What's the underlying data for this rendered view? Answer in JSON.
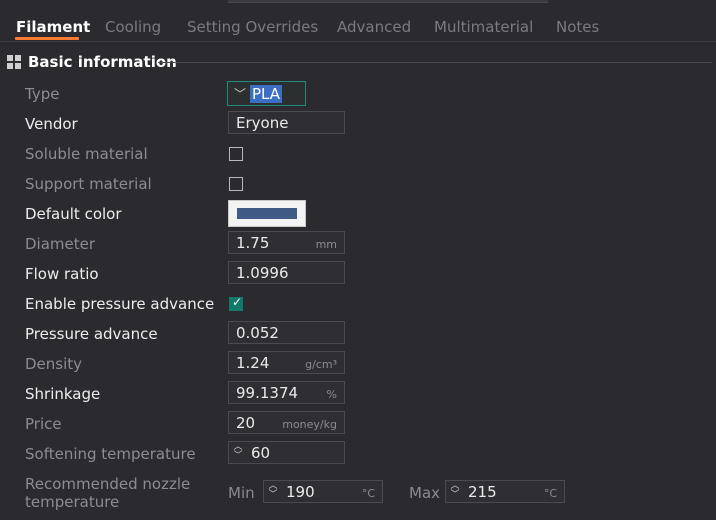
{
  "tabs": [
    {
      "label": "Filament",
      "active": true
    },
    {
      "label": "Cooling",
      "active": false
    },
    {
      "label": "Setting Overrides",
      "active": false
    },
    {
      "label": "Advanced",
      "active": false
    },
    {
      "label": "Multimaterial",
      "active": false
    },
    {
      "label": "Notes",
      "active": false
    }
  ],
  "section": {
    "title": "Basic information",
    "icon": "grid-icon"
  },
  "labels": {
    "type": "Type",
    "vendor": "Vendor",
    "soluble": "Soluble material",
    "support": "Support material",
    "default_color": "Default color",
    "diameter": "Diameter",
    "flow_ratio": "Flow ratio",
    "enable_pa": "Enable pressure advance",
    "pressure_advance": "Pressure advance",
    "density": "Density",
    "shrinkage": "Shrinkage",
    "price": "Price",
    "softening": "Softening temperature",
    "nozzle_line1": "Recommended nozzle",
    "nozzle_line2": "temperature"
  },
  "values": {
    "type": "PLA",
    "vendor": "Eryone",
    "soluble_checked": false,
    "support_checked": false,
    "default_color_hex": "#3f5a85",
    "diameter": "1.75",
    "flow_ratio": "1.0996",
    "enable_pa_checked": true,
    "pressure_advance": "0.052",
    "density": "1.24",
    "shrinkage": "99.1374",
    "price": "20",
    "softening": "60",
    "nozzle_min": "190",
    "nozzle_max": "215"
  },
  "units": {
    "diameter": "mm",
    "density": "g/cm³",
    "shrinkage": "%",
    "price": "money/kg",
    "nozzle": "°C"
  },
  "minmax": {
    "min_label": "Min",
    "max_label": "Max"
  },
  "colors": {
    "accent_tab": "#ff7a2f",
    "check_teal": "#127a6b",
    "selection_blue": "#3c6fc4"
  }
}
